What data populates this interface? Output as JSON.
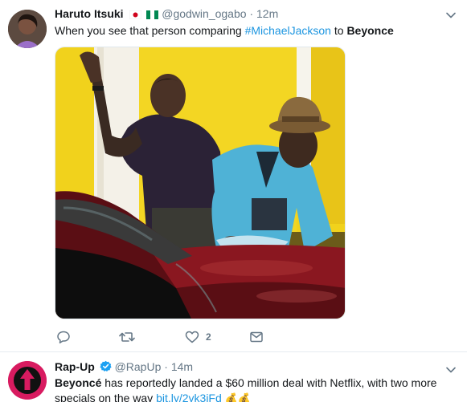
{
  "tweets": [
    {
      "name": "Haruto Itsuki",
      "handle": "@godwin_ogabo",
      "separator": "·",
      "time": "12m",
      "text_prefix": "When you see that person comparing ",
      "hashtag": "#MichaelJackson",
      "text_middle": " to ",
      "text_bold": "Beyonce",
      "likes": "2",
      "icons": [
        "caret-down-icon",
        "reply-icon",
        "retweet-icon",
        "like-icon",
        "message-icon"
      ]
    },
    {
      "name": "Rap-Up",
      "handle": "@RapUp",
      "separator": "·",
      "time": "14m",
      "text_bold": "Beyoncé",
      "text_rest": " has reportedly landed a $60 million deal with Netflix, with two more specials on the way ",
      "link": "bit.ly/2yk3iFd",
      "emoji": "💰💰",
      "icons": [
        "verified-icon",
        "caret-down-icon"
      ]
    }
  ],
  "colors": {
    "accent": "#1b95e0",
    "muted": "#657786",
    "rapup_brand": "#d81b60"
  }
}
